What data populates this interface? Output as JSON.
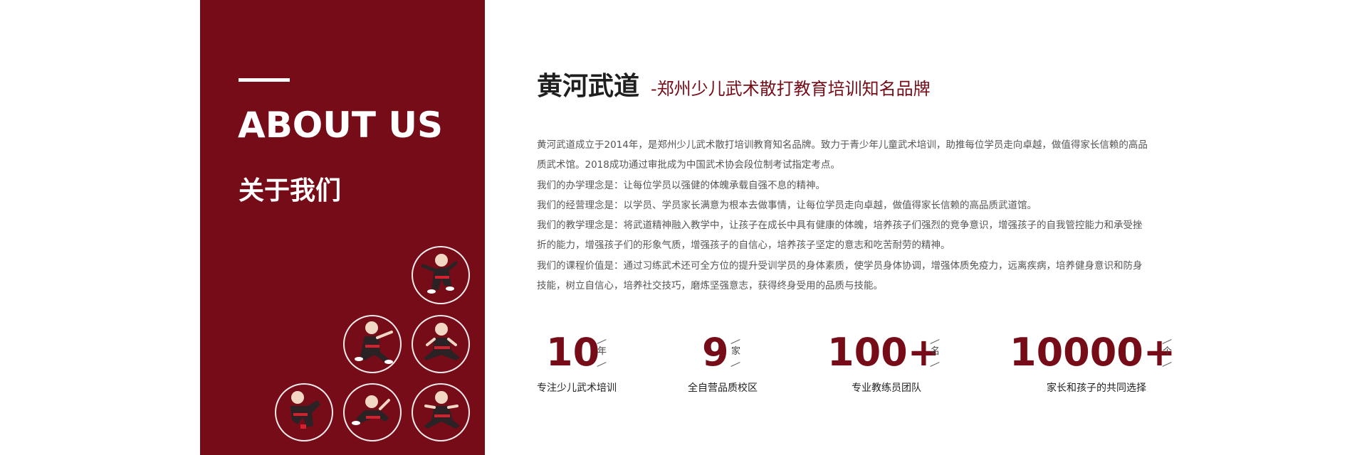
{
  "about": {
    "title": "ABOUT US",
    "subtitle_cn": "关于我们"
  },
  "heading": {
    "brand": "黄河武道",
    "slogan": "-郑州少儿武术散打教育培训知名品牌"
  },
  "intro": {
    "lines": [
      "黄河武道成立于2014年，是郑州少儿武术散打培训教育知名品牌。致力于青少年儿童武术培训，助推每位学员走向卓越，做值得家长信赖的高品",
      "质武术馆。2018成功通过审批成为中国武术协会段位制考试指定考点。",
      "我们的办学理念是：让每位学员以强健的体魄承载自强不息的精神。",
      "我们的经营理念是：以学员、学员家长满意为根本去做事情，让每位学员走向卓越，做值得家长信赖的高品质武道馆。",
      "我们的教学理念是：将武道精神融入教学中，让孩子在成长中具有健康的体魄，培养孩子们强烈的竞争意识，增强孩子的自我管控能力和承受挫",
      "折的能力，增强孩子们的形象气质，增强孩子的自信心，培养孩子坚定的意志和吃苦耐劳的精神。",
      "我们的课程价值是：通过习练武术还可全方位的提升受训学员的身体素质，使学员身体协调，增强体质免疫力，远离疾病，培养健身意识和防身",
      "技能，树立自信心，培养社交技巧，磨炼坚强意志，获得终身受用的品质与技能。"
    ]
  },
  "stats": [
    {
      "value": "10",
      "unit": "年",
      "label": "专注少儿武术培训"
    },
    {
      "value": "9",
      "unit": "家",
      "label": "全自营品质校区"
    },
    {
      "value": "100+",
      "unit": "名",
      "label": "专业教练员团队"
    },
    {
      "value": "10000+",
      "unit": "个",
      "label": "家长和孩子的共同选择"
    }
  ],
  "colors": {
    "brand_red": "#760c17",
    "text_dark": "#1f1f1f",
    "text_body": "#555555"
  },
  "icons": {
    "martial_artist": "martial-arts-kid-icon"
  }
}
